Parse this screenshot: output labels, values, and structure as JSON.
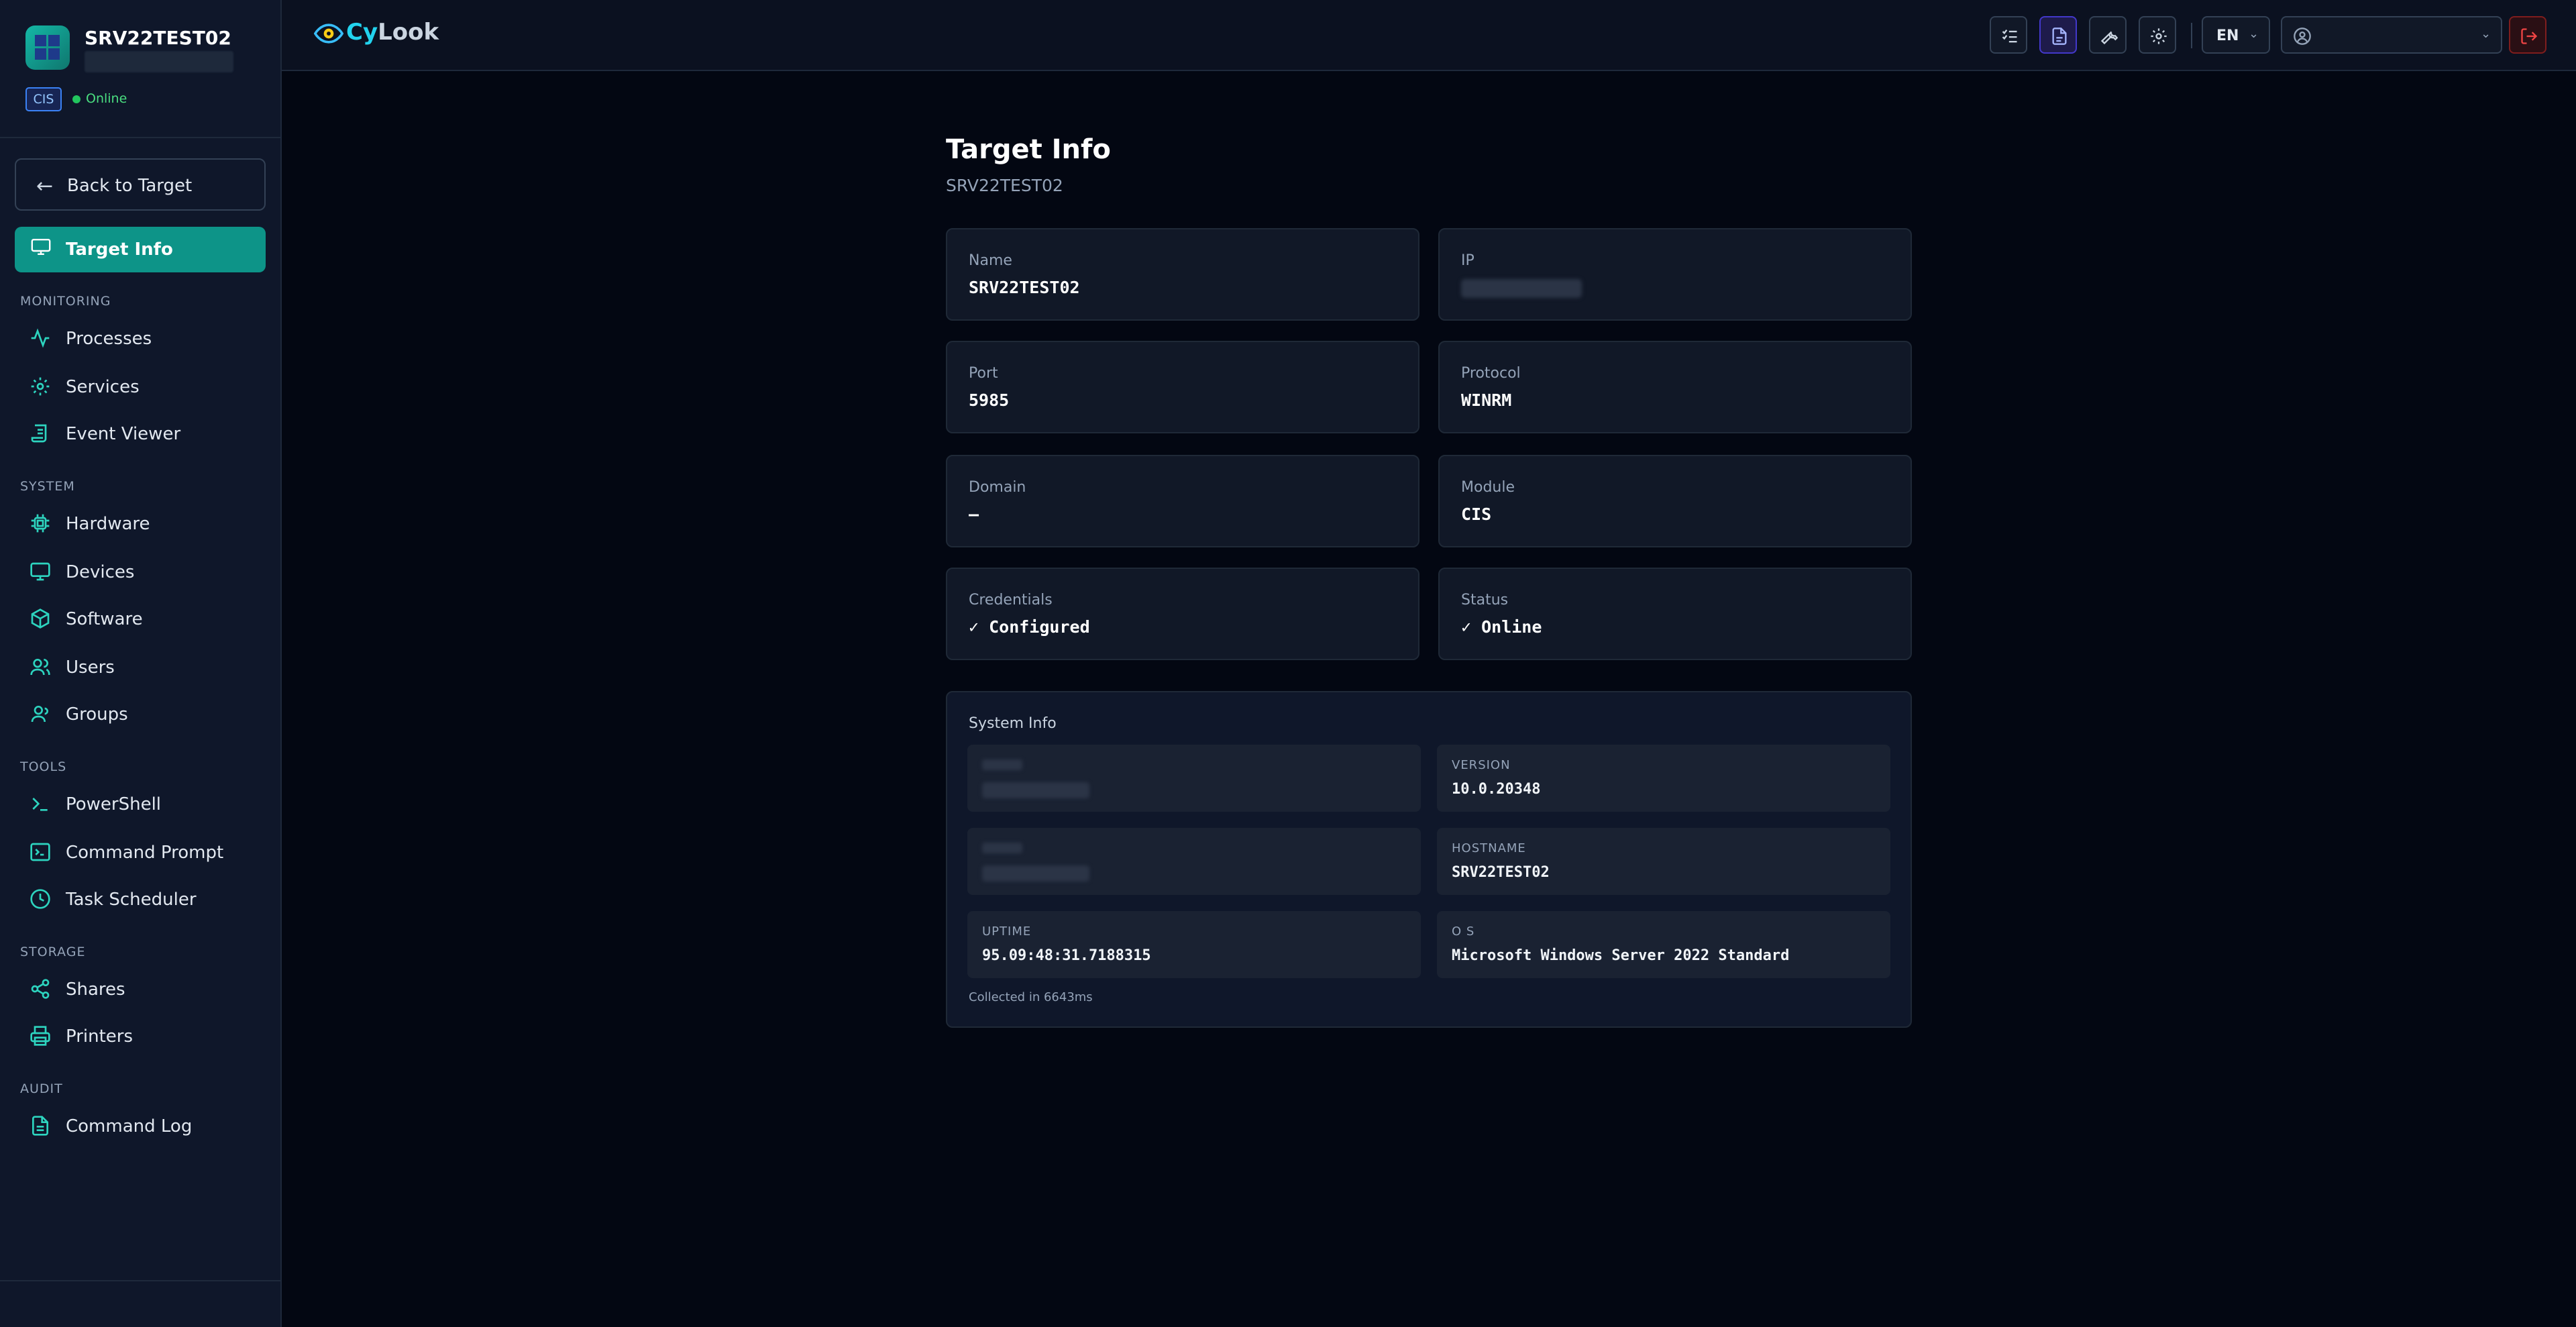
{
  "sidebar": {
    "hostname": "SRV22TEST02",
    "module_badge": "CIS",
    "status": "Online",
    "back_label": "Back to Target",
    "active_label": "Target Info",
    "sections": {
      "monitoring": "MONITORING",
      "system": "SYSTEM",
      "tools": "TOOLS",
      "storage": "STORAGE",
      "audit": "AUDIT"
    },
    "items": {
      "processes": "Processes",
      "services": "Services",
      "event_viewer": "Event Viewer",
      "hardware": "Hardware",
      "devices": "Devices",
      "software": "Software",
      "users": "Users",
      "groups": "Groups",
      "powershell": "PowerShell",
      "command_prompt": "Command Prompt",
      "task_scheduler": "Task Scheduler",
      "shares": "Shares",
      "printers": "Printers",
      "command_log": "Command Log"
    }
  },
  "topbar": {
    "brand_cy": "Cy",
    "brand_look": "Look",
    "language": "EN"
  },
  "main": {
    "title": "Target Info",
    "subtitle": "SRV22TEST02",
    "fields": {
      "name": {
        "label": "Name",
        "value": "SRV22TEST02"
      },
      "ip": {
        "label": "IP"
      },
      "port": {
        "label": "Port",
        "value": "5985"
      },
      "protocol": {
        "label": "Protocol",
        "value": "WINRM"
      },
      "domain": {
        "label": "Domain",
        "value": "—"
      },
      "module": {
        "label": "Module",
        "value": "CIS"
      },
      "credentials": {
        "label": "Credentials",
        "value": "✓ Configured"
      },
      "status": {
        "label": "Status",
        "value": "✓ Online"
      }
    },
    "system_info": {
      "title": "System Info",
      "version": {
        "key": "VERSION",
        "value": "10.0.20348"
      },
      "hostname": {
        "key": "HOSTNAME",
        "value": "SRV22TEST02"
      },
      "uptime": {
        "key": "UPTIME",
        "value": "95.09:48:31.7188315"
      },
      "os": {
        "key": "O S",
        "value": "Microsoft Windows Server 2022 Standard"
      },
      "collected": "Collected in 6643ms"
    }
  },
  "colors": {
    "accent": "#0d9488",
    "icon": "#2dd4bf",
    "online": "#22c55e",
    "background": "#030712",
    "sidebar": "#0f172a",
    "logout": "#ef4444"
  }
}
